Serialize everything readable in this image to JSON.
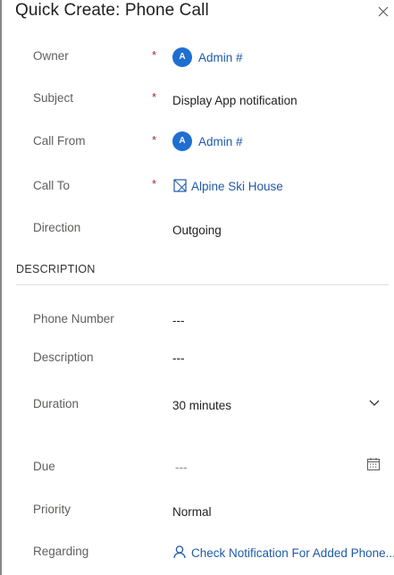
{
  "header": {
    "title": "Quick Create: Phone Call"
  },
  "fields": {
    "owner": {
      "label": "Owner",
      "required": "*",
      "avatar": "A",
      "value": "Admin #"
    },
    "subject": {
      "label": "Subject",
      "required": "*",
      "value": "Display App notification"
    },
    "call_from": {
      "label": "Call From",
      "required": "*",
      "avatar": "A",
      "value": "Admin #"
    },
    "call_to": {
      "label": "Call To",
      "required": "*",
      "value": "Alpine Ski House"
    },
    "direction": {
      "label": "Direction",
      "value": "Outgoing"
    }
  },
  "description_section": {
    "title": "DESCRIPTION",
    "phone_number": {
      "label": "Phone Number",
      "value": "---"
    },
    "description": {
      "label": "Description",
      "value": "---"
    },
    "duration": {
      "label": "Duration",
      "value": "30 minutes"
    },
    "due": {
      "label": "Due",
      "value": "---"
    },
    "priority": {
      "label": "Priority",
      "value": "Normal"
    },
    "regarding": {
      "label": "Regarding",
      "value": "Check Notification For Added Phone..."
    }
  },
  "icons": {
    "close": "close-icon",
    "avatar": "user-avatar",
    "account": "account-icon",
    "dropdown": "chevron-down-icon",
    "calendar": "calendar-icon",
    "regarding": "person-icon"
  },
  "colors": {
    "link": "#1e5aa8",
    "required": "#a4262c",
    "avatar": "#1f6fd0"
  }
}
